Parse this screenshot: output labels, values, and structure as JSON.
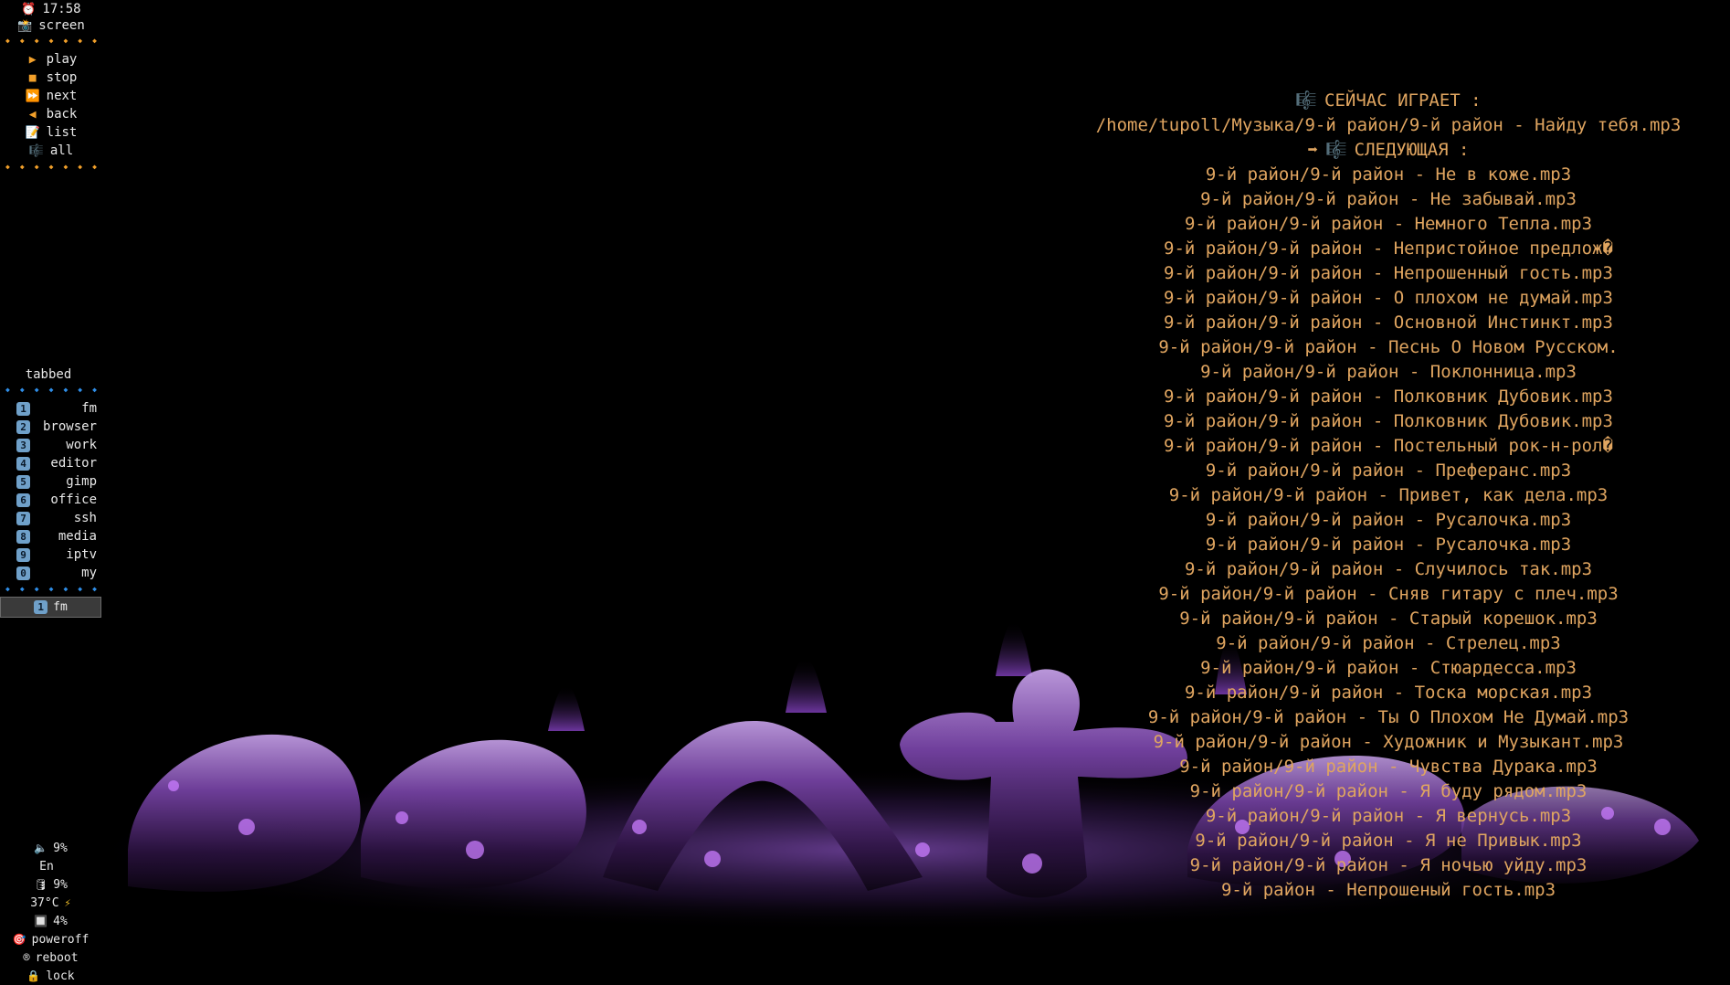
{
  "sidebar": {
    "clock": {
      "icon": "alarm-clock-icon",
      "text": "17:58"
    },
    "screen": {
      "icon": "camera-icon",
      "text": "screen"
    },
    "player_controls": [
      {
        "icon": "play-icon",
        "label": "play"
      },
      {
        "icon": "stop-icon",
        "label": "stop"
      },
      {
        "icon": "fast-forward-icon",
        "label": "next"
      },
      {
        "icon": "rewind-icon",
        "label": "back"
      },
      {
        "icon": "memo-icon",
        "label": "list"
      },
      {
        "icon": "music-score-icon",
        "label": "all"
      }
    ],
    "layout_label": "tabbed",
    "workspaces": [
      {
        "num": "1",
        "label": "fm"
      },
      {
        "num": "2",
        "label": "browser"
      },
      {
        "num": "3",
        "label": "work"
      },
      {
        "num": "4",
        "label": "editor"
      },
      {
        "num": "5",
        "label": "gimp"
      },
      {
        "num": "6",
        "label": "office"
      },
      {
        "num": "7",
        "label": "ssh"
      },
      {
        "num": "8",
        "label": "media"
      },
      {
        "num": "9",
        "label": "iptv"
      },
      {
        "num": "0",
        "label": "my"
      }
    ],
    "active_workspace": {
      "num": "1",
      "label": "fm"
    },
    "status": {
      "volume": "9%",
      "keyboard_layout": "En",
      "disk": "9%",
      "temperature": "37°C",
      "cpu": "4%"
    },
    "power": [
      {
        "icon": "target-icon",
        "label": "poweroff"
      },
      {
        "icon": "registered-icon",
        "label": "reboot"
      },
      {
        "icon": "lock-icon",
        "label": "lock"
      }
    ]
  },
  "player": {
    "now_playing_label": "СЕЙЧАС ИГРАЕТ :",
    "now_playing_path": "/home/tupoll/Музыка/9-й район/9-й район - Найду тебя.mp3",
    "next_label": "СЛЕДУЮЩАЯ :",
    "queue": [
      "9-й район/9-й район - Не в коже.mp3",
      "9-й район/9-й район - Не забывай.mp3",
      "9-й район/9-й район - Немного Тепла.mp3",
      "9-й район/9-й район - Непристойное предлож�",
      "9-й район/9-й район - Непрошенный гость.mp3",
      "9-й район/9-й район - О плохом не думай.mp3",
      "9-й район/9-й район - Основной Инстинкт.mp3",
      "9-й район/9-й район - Песнь О Новом Русском.",
      "9-й район/9-й район - Поклонница.mp3",
      "9-й район/9-й район - Полковник Дубовик.mp3",
      "9-й район/9-й район - Полковник Дубовик.mp3",
      "9-й район/9-й район - Постельный рок-н-рол�",
      "9-й район/9-й район - Преферанс.mp3",
      "9-й район/9-й район - Привет, как дела.mp3",
      "9-й район/9-й район - Русалочка.mp3",
      "9-й район/9-й район - Русалочка.mp3",
      "9-й район/9-й район - Случилось так.mp3",
      "9-й район/9-й район - Сняв гитару с плеч.mp3",
      "9-й район/9-й район - Старый корешок.mp3",
      "9-й район/9-й район - Стрелец.mp3",
      "9-й район/9-й район - Стюардесса.mp3",
      "9-й район/9-й район - Тоска морская.mp3",
      "9-й район/9-й район - Ты О Плохом Не Думай.mp3",
      "9-й район/9-й район - Художник и Музыкант.mp3",
      "9-й район/9-й район - Чувства Дурака.mp3",
      "9-й район/9-й район - Я буду рядом.mp3",
      "9-й район/9-й район - Я вернусь.mp3",
      "9-й район/9-й район - Я не Привык.mp3",
      "9-й район/9-й район - Я ночью уйду.mp3",
      "9-й район - Непрошеный гость.mp3"
    ]
  },
  "colors": {
    "background": "#000000",
    "player_text": "#e0a560",
    "sidebar_text": "#e8e8e8",
    "separator_orange": "#f2a02a",
    "separator_blue": "#2f8ee8",
    "wallpaper_accent": "#8a4fc7"
  }
}
